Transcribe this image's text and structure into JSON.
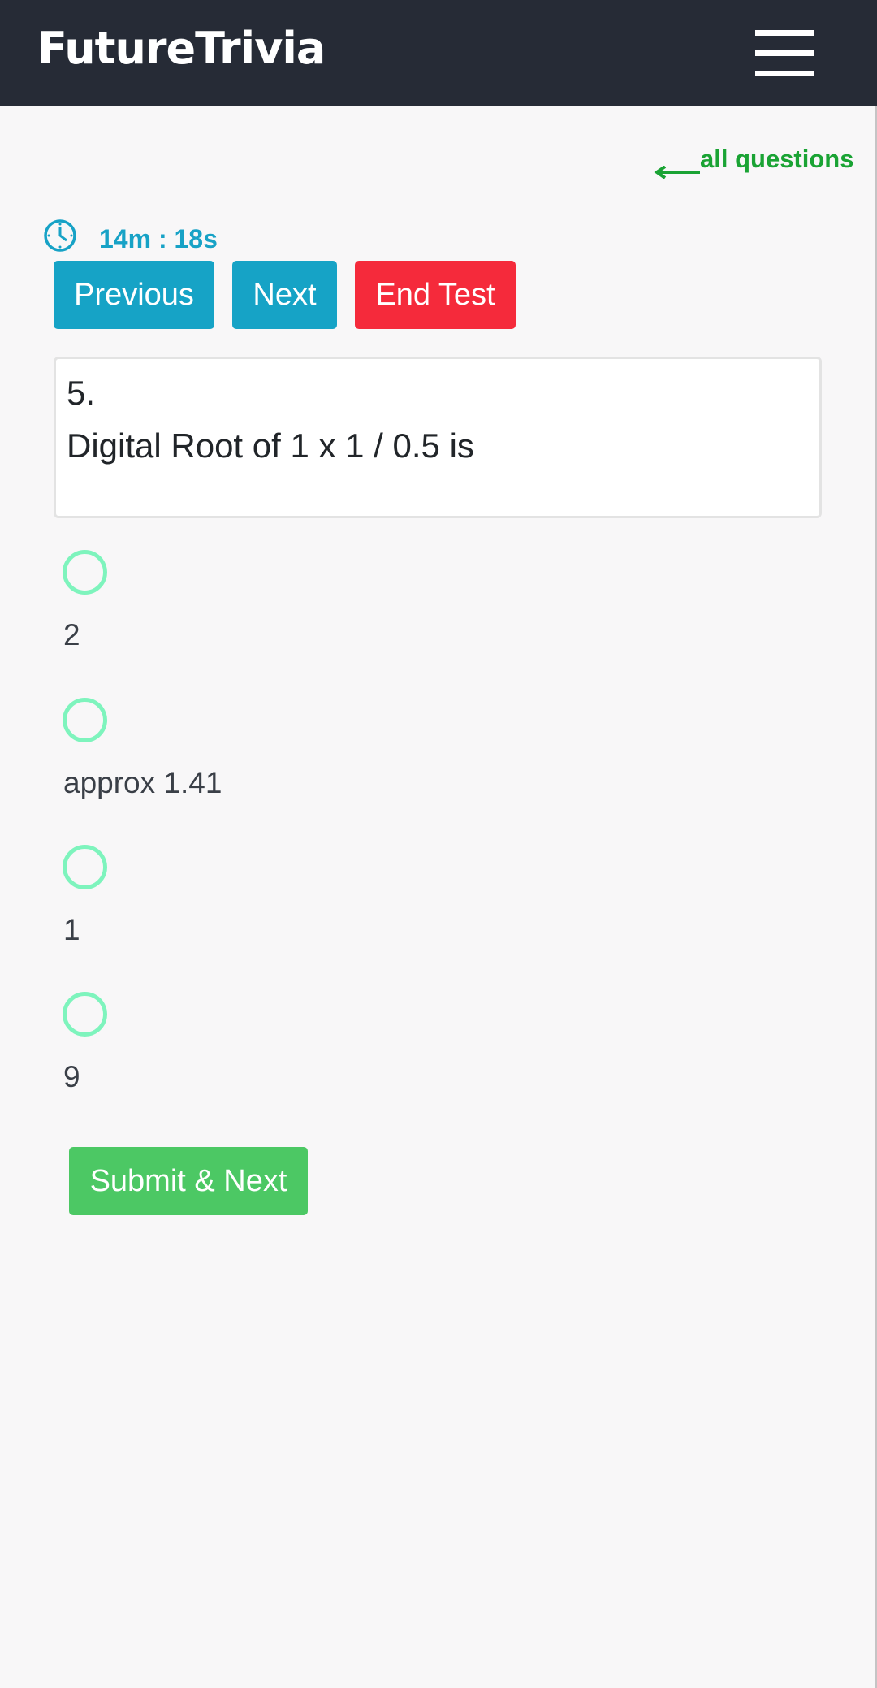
{
  "header": {
    "brand": "FutureTrivia",
    "menu_icon": "hamburger-menu-icon"
  },
  "nav": {
    "all_questions_label": "all questions",
    "arrow_icon": "arrow-left-icon"
  },
  "timer": {
    "icon": "clock-icon",
    "value": "14m : 18s"
  },
  "controls": {
    "previous_label": "Previous",
    "next_label": "Next",
    "end_label": "End Test"
  },
  "question": {
    "number": "5.",
    "text": "Digital Root of 1 x 1 / 0.5 is"
  },
  "options": [
    {
      "label": "2"
    },
    {
      "label": "approx 1.41"
    },
    {
      "label": "1"
    },
    {
      "label": "9"
    }
  ],
  "submit_label": "Submit & Next",
  "colors": {
    "header_bg": "#262b36",
    "primary": "#16a3c6",
    "danger": "#f52a3b",
    "success": "#4cc864",
    "link_green": "#1aa334",
    "radio_border": "#7ef4bd",
    "page_bg": "#f8f7f8"
  }
}
